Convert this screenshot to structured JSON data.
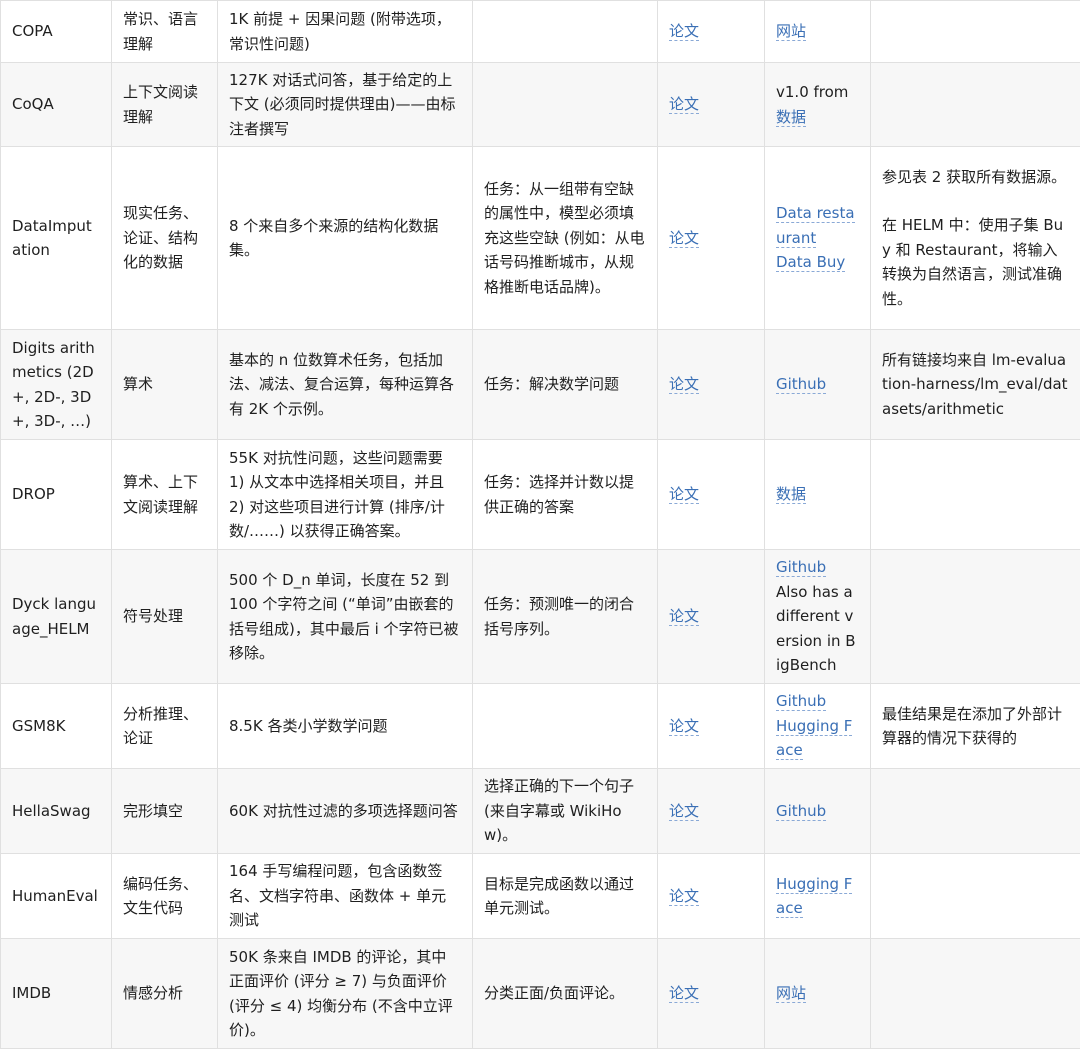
{
  "rows": [
    {
      "name": "COPA",
      "category": "常识、语言理解",
      "description": "1K 前提 + 因果问题 (附带选项，常识性问题)",
      "task": "",
      "paper": "论文",
      "links": [
        {
          "text": "网站",
          "link": true
        }
      ],
      "notes": []
    },
    {
      "name": "CoQA",
      "category": "上下文阅读理解",
      "description": "127K 对话式问答，基于给定的上下文 (必须同时提供理由)——由标注者撰写",
      "task": "",
      "paper": "论文",
      "links": [
        {
          "text": "v1.0 from ",
          "link": false
        },
        {
          "text": "数据",
          "link": true
        }
      ],
      "notes": []
    },
    {
      "name": "DataImputation",
      "category": "现实任务、论证、结构化的数据",
      "description": "8 个来自多个来源的结构化数据集。",
      "task": "任务：从一组带有空缺的属性中，模型必须填充这些空缺 (例如：从电话号码推断城市，从规格推断电话品牌)。",
      "paper": "论文",
      "links": [
        {
          "text": "Data restaurant",
          "link": true
        },
        {
          "text": "Data Buy",
          "link": true
        }
      ],
      "notes": [
        "参见表 2 获取所有数据源。",
        "在 HELM 中：使用子集 Buy 和 Restaurant，将输入转换为自然语言，测试准确性。"
      ]
    },
    {
      "name": "Digits arithmetics (2D+, 2D-, 3D+, 3D-, …)",
      "category": "算术",
      "description": "基本的 n 位数算术任务，包括加法、减法、复合运算，每种运算各有 2K 个示例。",
      "task": "任务：解决数学问题",
      "paper": "论文",
      "links": [
        {
          "text": "Github",
          "link": true
        }
      ],
      "notes": [
        "所有链接均来自 lm-evaluation-harness/lm_eval/datasets/arithmetic"
      ]
    },
    {
      "name": "DROP",
      "category": "算术、上下文阅读理解",
      "description": "55K 对抗性问题，这些问题需要 1) 从文本中选择相关项目，并且 2) 对这些项目进行计算 (排序/计数/……) 以获得正确答案。",
      "task": "任务：选择并计数以提供正确的答案",
      "paper": "论文",
      "links": [
        {
          "text": "数据",
          "link": true
        }
      ],
      "notes": []
    },
    {
      "name": "Dyck language_HELM",
      "category": "符号处理",
      "description": "500 个 D_n 单词，长度在 52 到 100 个字符之间 (“单词”由嵌套的括号组成)，其中最后 i 个字符已被移除。",
      "task": "任务：预测唯一的闭合括号序列。",
      "paper": "论文",
      "links": [
        {
          "text": "Github",
          "link": true
        },
        {
          "text": "Also has a different version in BigBench",
          "link": false
        }
      ],
      "notes": []
    },
    {
      "name": "GSM8K",
      "category": "分析推理、论证",
      "description": "8.5K 各类小学数学问题",
      "task": "",
      "paper": "论文",
      "links": [
        {
          "text": "Github",
          "link": true
        },
        {
          "text": "Hugging Face",
          "link": true
        }
      ],
      "notes": [
        "最佳结果是在添加了外部计算器的情况下获得的"
      ]
    },
    {
      "name": "HellaSwag",
      "category": "完形填空",
      "description": "60K 对抗性过滤的多项选择题问答",
      "task": "选择正确的下一个句子 (来自字幕或 WikiHow)。",
      "paper": "论文",
      "links": [
        {
          "text": "Github",
          "link": true
        }
      ],
      "notes": []
    },
    {
      "name": "HumanEval",
      "category": "编码任务、文生代码",
      "description": "164 手写编程问题，包含函数签名、文档字符串、函数体 + 单元测试",
      "task": "目标是完成函数以通过单元测试。",
      "paper": "论文",
      "links": [
        {
          "text": "Hugging Face",
          "link": true
        }
      ],
      "notes": []
    },
    {
      "name": "IMDB",
      "category": "情感分析",
      "description": "50K 条来自 IMDB 的评论，其中正面评价 (评分 ≥ 7) 与负面评价 (评分 ≤ 4) 均衡分布 (不含中立评价)。",
      "task": "分类正面/负面评论。",
      "paper": "论文",
      "links": [
        {
          "text": "网站",
          "link": true
        }
      ],
      "notes": []
    }
  ]
}
